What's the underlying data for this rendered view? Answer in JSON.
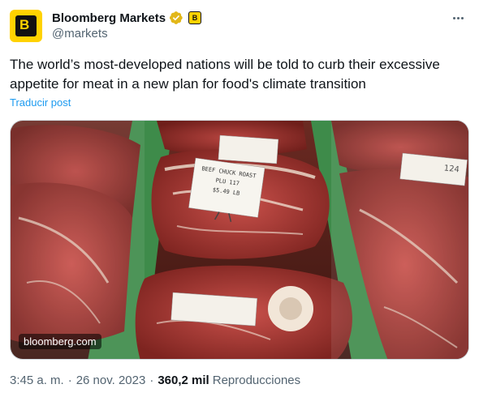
{
  "author": {
    "display_name": "Bloomberg Markets",
    "handle": "@markets",
    "avatar_letter": "B",
    "affiliate_badge_letter": "B"
  },
  "tweet": {
    "text": "The world’s most-developed nations will be told to curb their excessive appetite for meat in a new plan for food's climate transition",
    "translate_label": "Traducir post"
  },
  "media": {
    "domain": "bloomberg.com",
    "price_tags": [
      "BEEF CHUCK ROAST",
      "PLU 117",
      "$5.49 LB",
      "124"
    ]
  },
  "meta": {
    "time": "3:45 a. m.",
    "separator": "·",
    "date": "26 nov. 2023",
    "views_count": "360,2 mil",
    "views_label": "Reproducciones"
  },
  "colors": {
    "accent": "#1d9bf0",
    "verified": "#e2b719",
    "brand_yellow": "#ffd200",
    "secondary_text": "#536471"
  },
  "icons": {
    "verified": "verified-badge-icon",
    "more": "more-icon"
  }
}
